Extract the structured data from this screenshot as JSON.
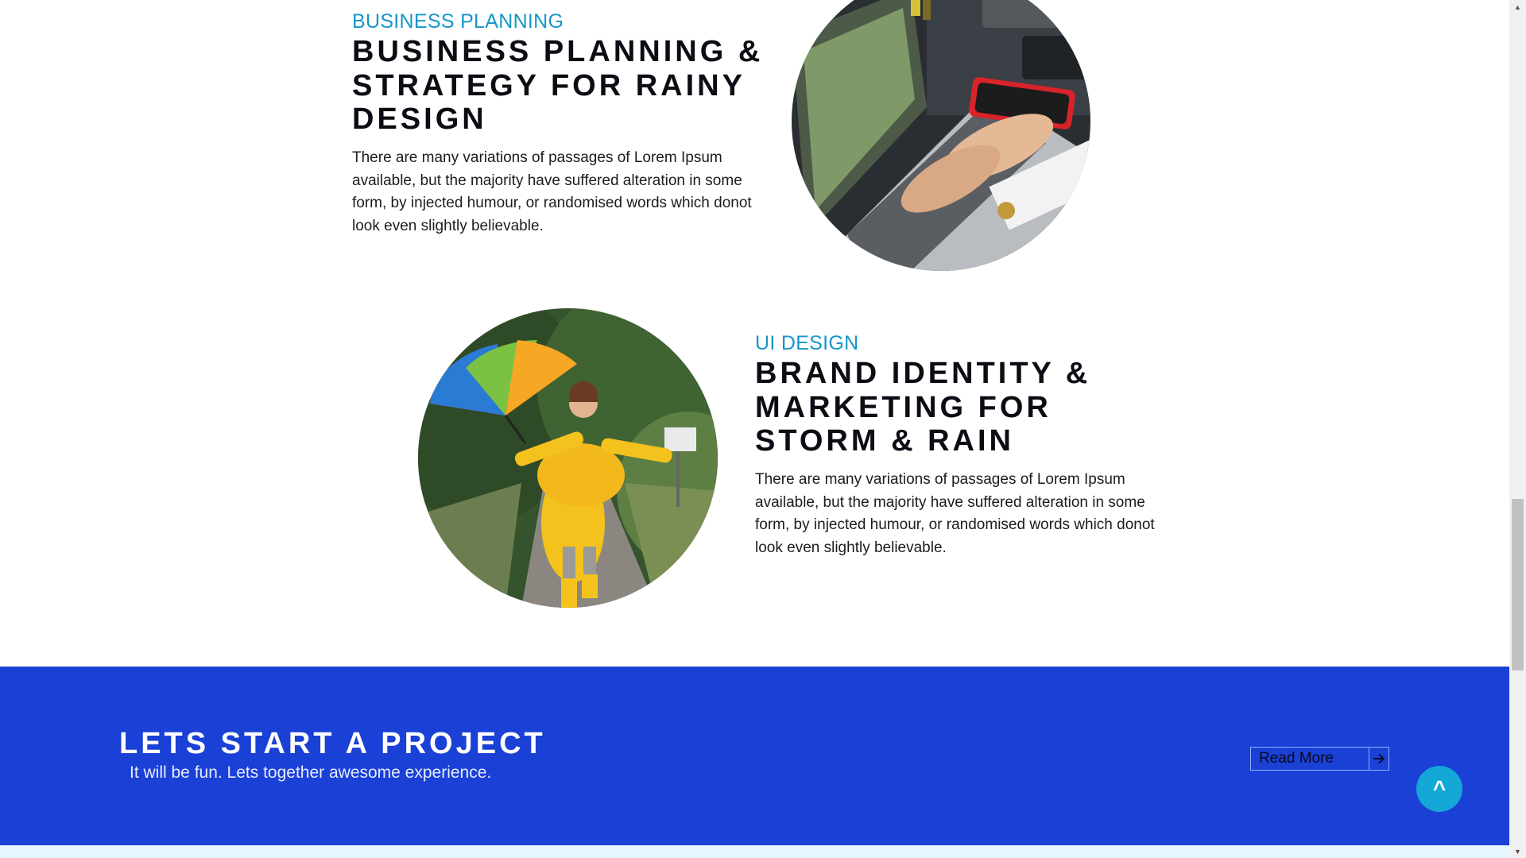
{
  "section1": {
    "tag": "BUSINESS PLANNING",
    "title": "BUSINESS PLANNING & STRATEGY FOR RAINY DESIGN",
    "body": "There are many variations of passages of Lorem Ipsum available, but the majority have suffered alteration in some form, by injected humour, or randomised words which donot look even slightly believable."
  },
  "section2": {
    "tag": "UI DESIGN",
    "title": "BRAND IDENTITY & MARKETING FOR STORM & RAIN",
    "body": "There are many variations of passages of Lorem Ipsum available, but the majority have suffered alteration in some form, by injected humour, or randomised words which donot look even slightly believable."
  },
  "cta": {
    "title": "LETS START A PROJECT",
    "subtitle": "It will be fun. Lets together awesome experience.",
    "button_label": "Read More",
    "button_icon": "arrow-right-icon",
    "accent_color": "#1a40d6"
  },
  "scroll_top": {
    "label": "^",
    "color": "#13a8d6"
  }
}
